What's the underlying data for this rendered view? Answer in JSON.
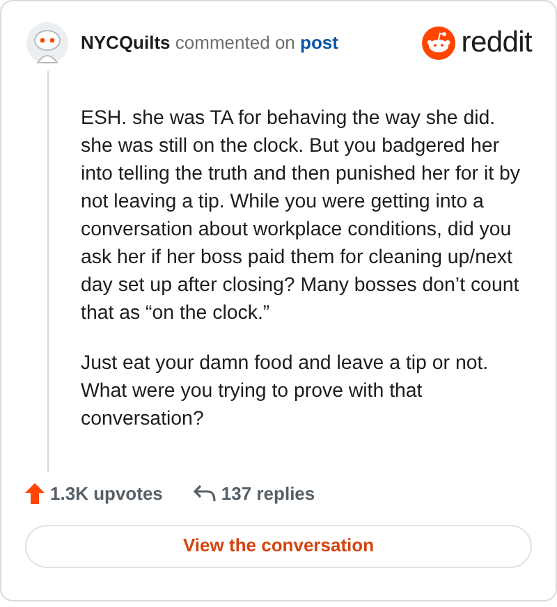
{
  "comment": {
    "author": "NYCQuilts",
    "action": "commented on",
    "target": "post",
    "paragraphs": [
      "ESH. she was TA for behaving the way she did. she was still on the clock. But you badgered her into telling the truth and then punished her for it by not leaving a tip. While you were getting into a conversation about workplace conditions, did you ask her if her boss paid them for cleaning up/next day set up after closing? Many bosses don’t count that as “on the clock.”",
      "Just eat your damn food and leave a tip or not. What were you trying to prove with that conversation?"
    ]
  },
  "brand": "reddit",
  "stats": {
    "upvotes": "1.3K upvotes",
    "replies": "137 replies"
  },
  "button": "View the conversation"
}
